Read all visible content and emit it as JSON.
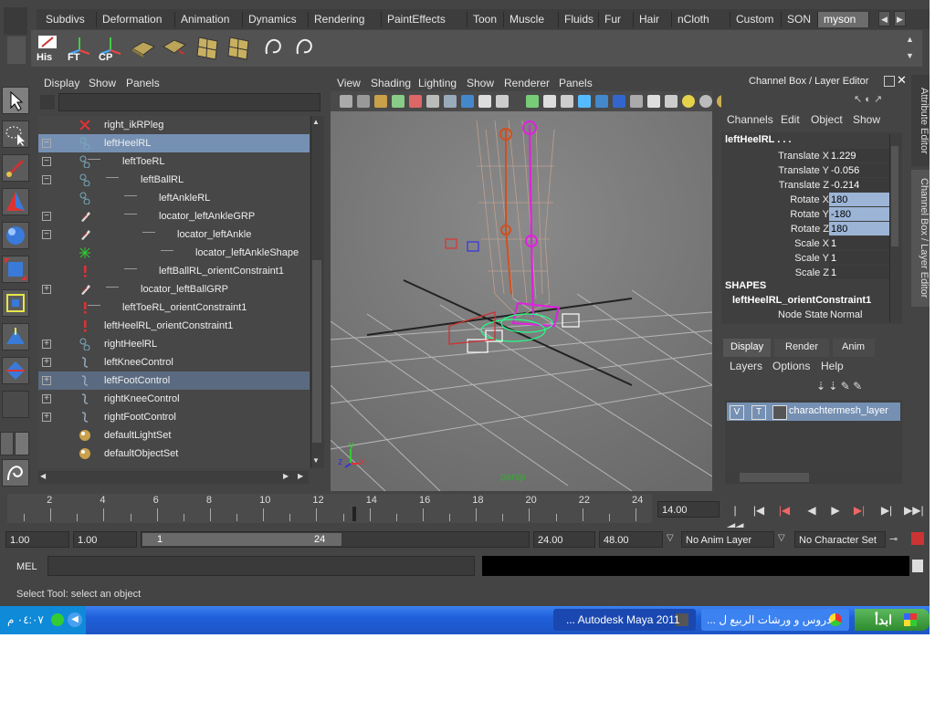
{
  "shelf": {
    "tabs": [
      "Subdivs",
      "Deformation",
      "Animation",
      "Dynamics",
      "Rendering",
      "PaintEffects",
      "Toon",
      "Muscle",
      "Fluids",
      "Fur",
      "Hair",
      "nCloth",
      "Custom",
      "SON",
      "myson"
    ],
    "icon_labels": [
      "His",
      "FT",
      "CP"
    ]
  },
  "outliner": {
    "menus": [
      "Display",
      "Show",
      "Panels"
    ],
    "rows": [
      {
        "label": "right_ikRPleg",
        "expander": "",
        "icon": "ik-handle-icon"
      },
      {
        "label": "leftHeelRL",
        "expander": "−",
        "icon": "joint-icon"
      },
      {
        "label": "leftToeRL",
        "expander": "−",
        "icon": "joint-icon"
      },
      {
        "label": "leftBallRL",
        "expander": "−",
        "icon": "joint-icon"
      },
      {
        "label": "leftAnkleRL",
        "expander": "",
        "icon": "joint-icon"
      },
      {
        "label": "locator_leftAnkleGRP",
        "expander": "−",
        "icon": "locator-group-icon"
      },
      {
        "label": "locator_leftAnkle",
        "expander": "−",
        "icon": "locator-group-icon"
      },
      {
        "label": "locator_leftAnkleShape",
        "expander": "",
        "icon": "locator-icon"
      },
      {
        "label": "leftBallRL_orientConstraint1",
        "expander": "",
        "icon": "constraint-icon"
      },
      {
        "label": "locator_leftBallGRP",
        "expander": "+",
        "icon": "locator-group-icon"
      },
      {
        "label": "leftToeRL_orientConstraint1",
        "expander": "",
        "icon": "constraint-icon"
      },
      {
        "label": "leftHeelRL_orientConstraint1",
        "expander": "",
        "icon": "constraint-icon"
      },
      {
        "label": "rightHeelRL",
        "expander": "+",
        "icon": "joint-icon"
      },
      {
        "label": "leftKneeControl",
        "expander": "+",
        "icon": "curve-icon"
      },
      {
        "label": "leftFootControl",
        "expander": "+",
        "icon": "curve-icon"
      },
      {
        "label": "rightKneeControl",
        "expander": "+",
        "icon": "curve-icon"
      },
      {
        "label": "rightFootControl",
        "expander": "+",
        "icon": "curve-icon"
      },
      {
        "label": "defaultLightSet",
        "expander": "",
        "icon": "set-icon"
      },
      {
        "label": "defaultObjectSet",
        "expander": "",
        "icon": "set-icon"
      }
    ]
  },
  "viewport": {
    "menus": [
      "View",
      "Shading",
      "Lighting",
      "Show",
      "Renderer",
      "Panels"
    ],
    "camera_label": "persp",
    "axis_x": "x",
    "axis_y": "y",
    "axis_z": "z"
  },
  "channel_box": {
    "title": "Channel Box / Layer Editor",
    "menus": [
      "Channels",
      "Edit",
      "Object",
      "Show"
    ],
    "node_name": "leftHeelRL . . .",
    "channels": [
      {
        "label": "Translate X",
        "value": "1.229",
        "selected": false
      },
      {
        "label": "Translate Y",
        "value": "-0.056",
        "selected": false
      },
      {
        "label": "Translate Z",
        "value": "-0.214",
        "selected": false
      },
      {
        "label": "Rotate X",
        "value": "180",
        "selected": true
      },
      {
        "label": "Rotate Y",
        "value": "-180",
        "selected": true
      },
      {
        "label": "Rotate Z",
        "value": "180",
        "selected": true
      },
      {
        "label": "Scale X",
        "value": "1",
        "selected": false
      },
      {
        "label": "Scale Y",
        "value": "1",
        "selected": false
      },
      {
        "label": "Scale Z",
        "value": "1",
        "selected": false
      }
    ],
    "shapes_header": "SHAPES",
    "shape_name": "leftHeelRL_orientConstraint1",
    "node_state_label": "Node State",
    "node_state_value": "Normal",
    "layer_tabs": [
      "Display",
      "Render",
      "Anim"
    ],
    "layer_menus": [
      "Layers",
      "Options",
      "Help"
    ],
    "layer": {
      "v": "V",
      "t": "T",
      "name": "charachtermesh_layer"
    },
    "side_tabs": [
      "Attribute Editor",
      "Channel Box / Layer Editor"
    ]
  },
  "timeline": {
    "ticks": [
      "2",
      "4",
      "6",
      "8",
      "10",
      "12",
      "14",
      "16",
      "18",
      "20",
      "22",
      "24"
    ],
    "current_time": "14.00"
  },
  "range": {
    "start": "1.00",
    "playback_start": "1.00",
    "slider_start": "1",
    "slider_end": "24",
    "playback_end": "24.00",
    "end": "48.00",
    "anim_layer": "No Anim Layer",
    "char_set": "No Character Set"
  },
  "command": {
    "label": "MEL"
  },
  "help_line": "Select Tool: select an object",
  "taskbar": {
    "start_label": "ابدأ",
    "tasks": [
      "... Autodesk Maya 2011",
      "... دروس و ورشات الربيع ل"
    ],
    "clock": "٠٤:٠٧ م"
  },
  "colors": {
    "highlight": "#7590b3",
    "selected_value": "#9cb4d6",
    "taskbar": "#1f5fd9",
    "start": "#3c9c3c"
  }
}
